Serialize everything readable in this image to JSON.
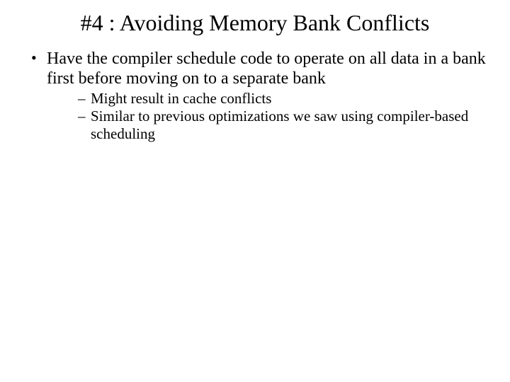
{
  "title": "#4 : Avoiding Memory Bank Conflicts",
  "bullets": [
    {
      "text": "Have the compiler schedule code to operate on all data in a bank first before moving on to a separate bank",
      "subs": [
        "Might result in cache conflicts",
        "Similar to previous optimizations we saw using compiler-based scheduling"
      ]
    }
  ]
}
